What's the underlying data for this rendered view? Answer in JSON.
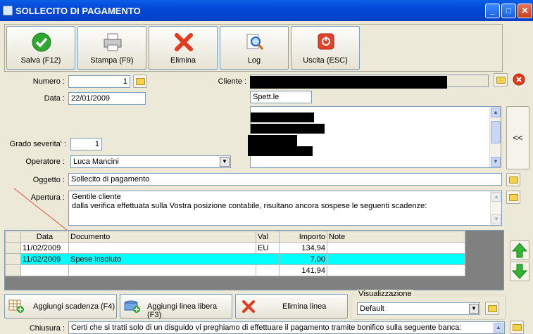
{
  "window": {
    "title": "SOLLECITO DI PAGAMENTO",
    "min": "_",
    "max": "□",
    "close": "✕"
  },
  "toolbar": {
    "save": "Salva (F12)",
    "print": "Stampa (F9)",
    "delete": "Elimina",
    "log": "Log",
    "exit": "Uscita (ESC)"
  },
  "form": {
    "numero_label": "Numero :",
    "numero_value": "1",
    "data_label": "Data :",
    "data_value": "22/01/2009",
    "cliente_label": "Cliente :",
    "spett_value": "Spett.le",
    "grado_label": "Grado severita' :",
    "grado_value": "1",
    "operatore_label": "Operatore :",
    "operatore_value": "Luca Mancini",
    "oggetto_label": "Oggetto :",
    "oggetto_value": "Sollecito di pagamento",
    "apertura_label": "Apertura :",
    "apertura_line1": "Gentile cliente",
    "apertura_line2": "dalla verifica effettuata sulla Vostra posizione contabile, risultano ancora sospese le seguenti scadenze:",
    "collapse_btn": "<<",
    "chiusura_label": "Chiusura :",
    "chiusura_value": "Certi che si tratti solo di un disguido vi preghiamo di effettuare il pagamento tramite bonifico sulla seguente banca:"
  },
  "table": {
    "headers": {
      "data": "Data",
      "documento": "Documento",
      "val": "Val",
      "importo": "Importo",
      "note": "Note"
    },
    "rows": [
      {
        "data": "11/02/2009",
        "documento": "",
        "val": "EU",
        "importo": "134,94",
        "note": ""
      },
      {
        "data": "11/02/2009",
        "documento": "Spese insoluto",
        "val": "",
        "importo": "7,00",
        "note": ""
      }
    ],
    "total": "141,94"
  },
  "bottom": {
    "add_due": "Aggiungi scadenza (F4)",
    "add_free": "Aggiungi linea libera (F3)",
    "delete_line": "Elimina linea",
    "view_label": "Visualizzazione",
    "view_value": "Default"
  },
  "colors": {
    "titlebar": "#0348d8",
    "selected_row": "#00ffff",
    "background": "#ece9d8"
  }
}
